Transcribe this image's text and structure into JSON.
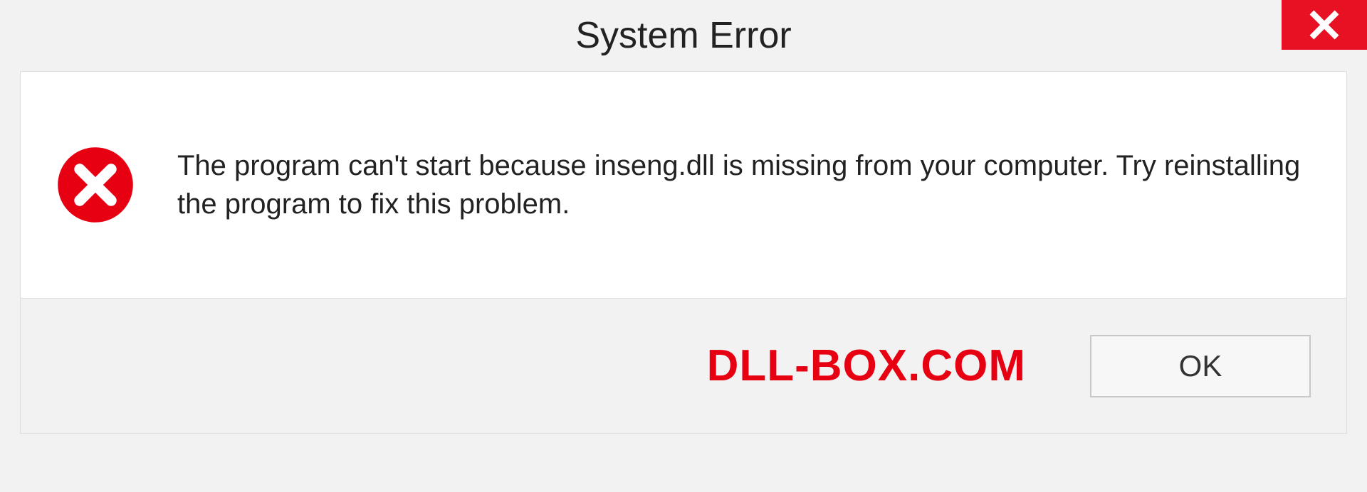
{
  "dialog": {
    "title": "System Error",
    "message": "The program can't start because inseng.dll is missing from your computer. Try reinstalling the program to fix this problem.",
    "ok_label": "OK",
    "watermark": "DLL-BOX.COM"
  }
}
